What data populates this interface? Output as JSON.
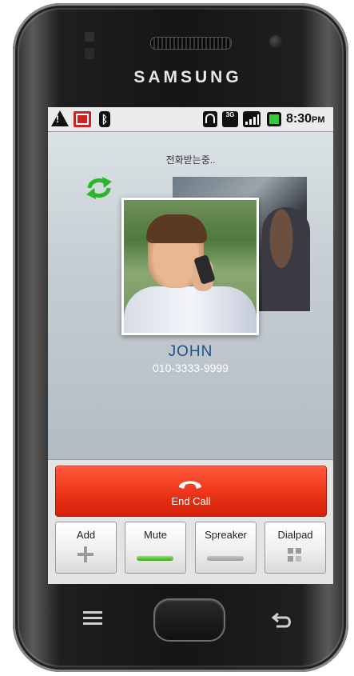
{
  "device": {
    "brand": "SAMSUNG"
  },
  "status_bar": {
    "time": "8:30",
    "ampm": "PM",
    "network_label": "3G",
    "icons": [
      "warning-icon",
      "missed-call-icon",
      "bluetooth-icon",
      "wifi-icon",
      "3g-icon",
      "signal-icon",
      "battery-icon"
    ]
  },
  "call": {
    "status_text": "전화받는중..",
    "caller_name": "JOHN",
    "caller_number": "010-3333-9999"
  },
  "controls": {
    "end_call_label": "End Call",
    "buttons": [
      {
        "label": "Add",
        "icon": "plus-icon"
      },
      {
        "label": "Mute",
        "icon": "indicator-on",
        "active": true
      },
      {
        "label": "Spreaker",
        "icon": "indicator-off",
        "active": false
      },
      {
        "label": "Dialpad",
        "icon": "dialpad-icon"
      }
    ]
  },
  "colors": {
    "end_call_red": "#f03a1e",
    "caller_name_blue": "#1e4f8a",
    "active_indicator_green": "#3ea81a"
  }
}
